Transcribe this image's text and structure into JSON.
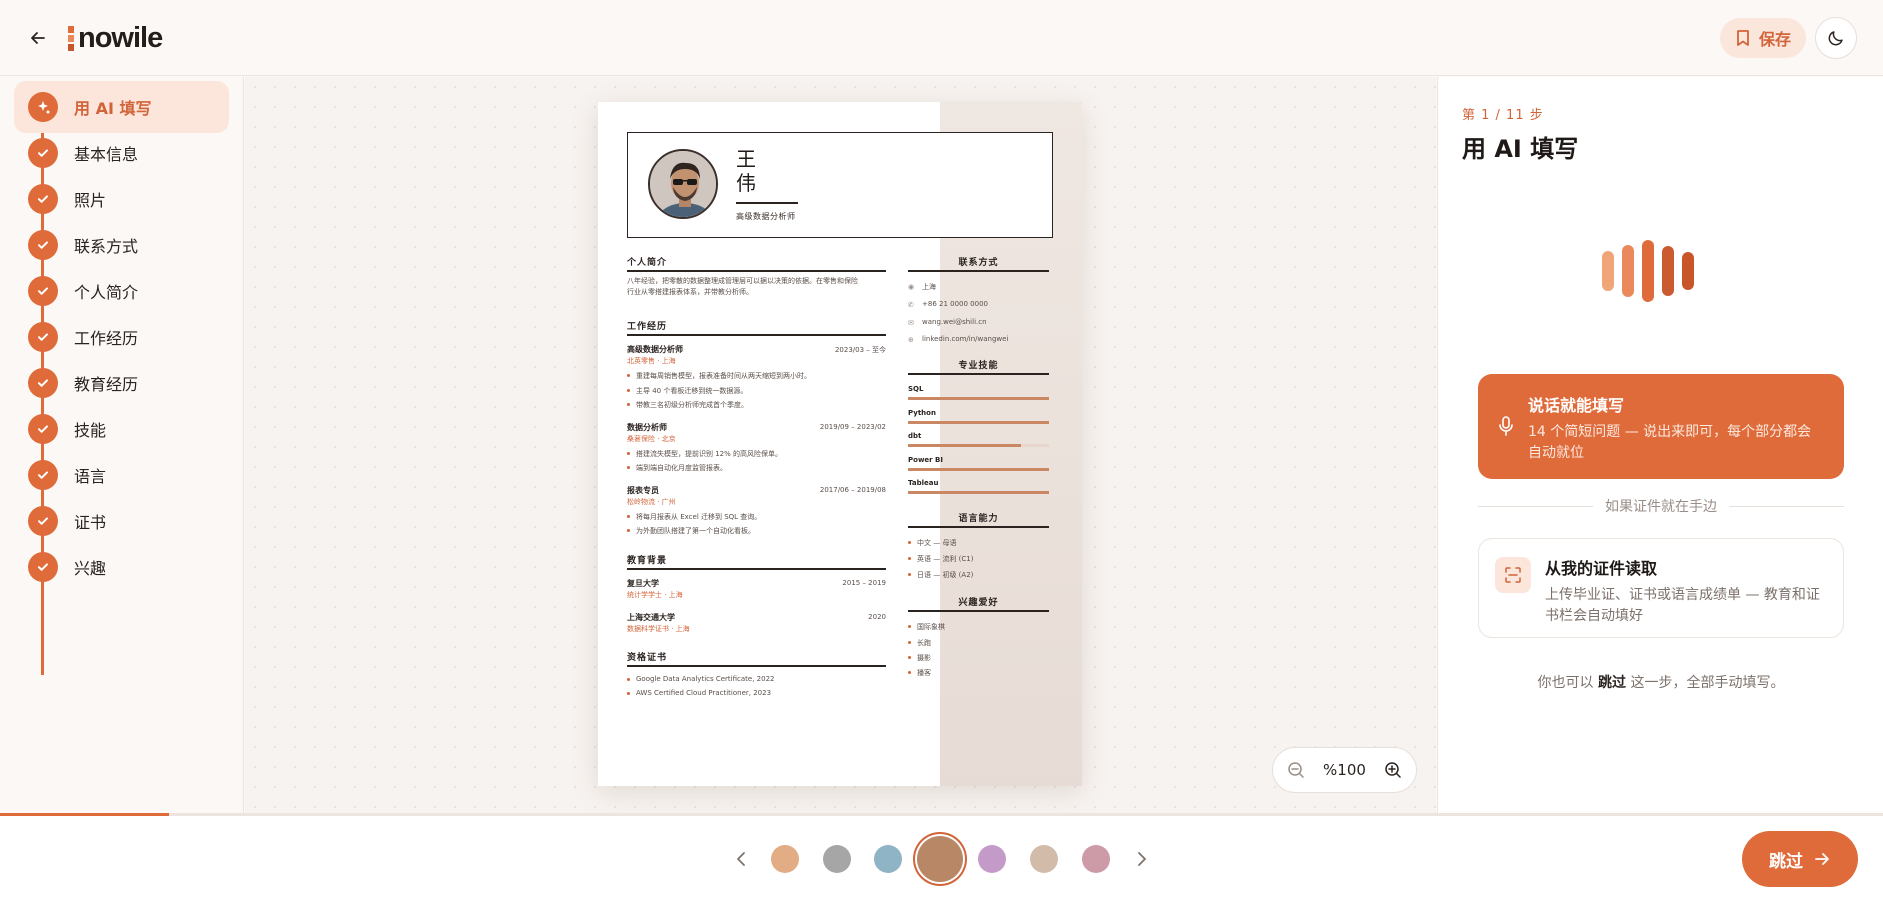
{
  "header": {
    "logo": "nowile",
    "save_label": "保存"
  },
  "sidebar": {
    "items": [
      {
        "label": "用 AI 填写",
        "active": true
      },
      {
        "label": "基本信息"
      },
      {
        "label": "照片"
      },
      {
        "label": "联系方式"
      },
      {
        "label": "个人简介"
      },
      {
        "label": "工作经历"
      },
      {
        "label": "教育经历"
      },
      {
        "label": "技能"
      },
      {
        "label": "语言"
      },
      {
        "label": "证书"
      },
      {
        "label": "兴趣"
      }
    ]
  },
  "resume": {
    "name_line1": "王",
    "name_line2": "伟",
    "title": "高级数据分析师",
    "summary_heading": "个人简介",
    "summary_line1": "八年经验，把零散的数据整理成管理层可以据以决策的依据。在零售和保险",
    "summary_line2": "行业从零搭建报表体系，并带教分析师。",
    "work_heading": "工作经历",
    "jobs": [
      {
        "title": "高级数据分析师",
        "org": "北英零售 · 上海",
        "date": "2023/03 – 至今",
        "bullets": [
          "重建每周销售模型，报表准备时间从两天缩短到两小时。",
          "主导 40 个看板迁移到统一数据源。",
          "带教三名初级分析师完成首个季度。"
        ]
      },
      {
        "title": "数据分析师",
        "org": "桑葚保险 · 北京",
        "date": "2019/09 – 2023/02",
        "bullets": [
          "搭建流失模型，提前识别 12% 的高风险保单。",
          "端到端自动化月度监管报表。"
        ]
      },
      {
        "title": "报表专员",
        "org": "松岭物流 · 广州",
        "date": "2017/06 – 2019/08",
        "bullets": [
          "将每月报表从 Excel 迁移到 SQL 查询。",
          "为外勤团队搭建了第一个自动化看板。"
        ]
      }
    ],
    "edu_heading": "教育背景",
    "education": [
      {
        "school": "复旦大学",
        "degree": "统计学学士 · 上海",
        "date": "2015 – 2019"
      },
      {
        "school": "上海交通大学",
        "degree": "数据科学证书 · 上海",
        "date": "2020"
      }
    ],
    "cert_heading": "资格证书",
    "certs": [
      "Google Data Analytics Certificate, 2022",
      "AWS Certified Cloud Practitioner, 2023"
    ],
    "contact_heading": "联系方式",
    "contacts": [
      {
        "icon": "location-icon",
        "text": "上海"
      },
      {
        "icon": "phone-icon",
        "text": "+86 21 0000 0000"
      },
      {
        "icon": "email-icon",
        "text": "wang.wei@shili.cn"
      },
      {
        "icon": "link-icon",
        "text": "linkedin.com/in/wangwei"
      }
    ],
    "skills_heading": "专业技能",
    "skills": [
      {
        "name": "SQL",
        "level": 1.0
      },
      {
        "name": "Python",
        "level": 1.0
      },
      {
        "name": "dbt",
        "level": 0.8
      },
      {
        "name": "Power BI",
        "level": 1.0
      },
      {
        "name": "Tableau",
        "level": 1.0
      }
    ],
    "lang_heading": "语言能力",
    "languages": [
      "中文 — 母语",
      "英语 — 流利 (C1)",
      "日语 — 初级 (A2)"
    ],
    "hobby_heading": "兴趣爱好",
    "hobbies": [
      "国际象棋",
      "长跑",
      "摄影",
      "播客"
    ]
  },
  "zoom": {
    "value": "%100"
  },
  "panel": {
    "step_count": "第 1 / 11 步",
    "title": "用 AI 填写",
    "voice_title": "说话就能填写",
    "voice_desc": "14 个简短问题 — 说出来即可，每个部分都会自动就位",
    "divider": "如果证件就在手边",
    "doc_title": "从我的证件读取",
    "doc_desc": "上传毕业证、证书或语言成绩单 — 教育和证书栏会自动填好",
    "skip_prefix": "你也可以",
    "skip_word": "跳过",
    "skip_suffix": "这一步，全部手动填写。"
  },
  "progress": {
    "fraction": 0.09
  },
  "colors": {
    "accent": "#e06b3a",
    "swatches": [
      "#e2ad85",
      "#a6a6a6",
      "#8fb4c6",
      "#b88766",
      "#c39ac8",
      "#d2bba8",
      "#cd9aa8"
    ],
    "selected_swatch": 3
  },
  "footer": {
    "skip_label": "跳过"
  }
}
